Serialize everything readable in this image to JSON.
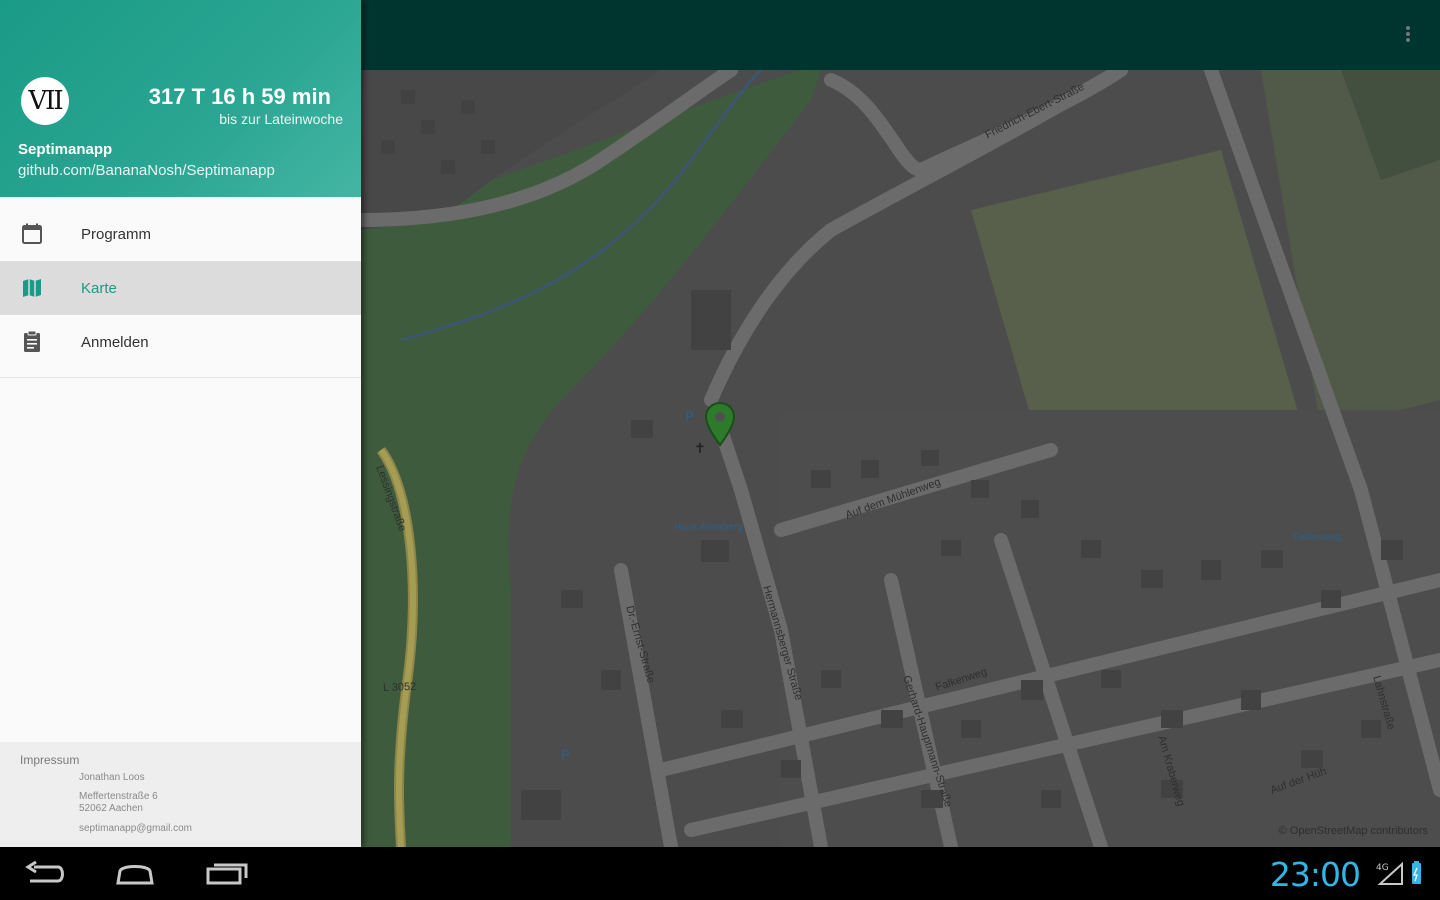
{
  "drawer": {
    "logo_text": "VII",
    "countdown": "317 T 16 h 59 min",
    "countdown_subtitle": "bis zur Lateinwoche",
    "app_name": "Septimanapp",
    "app_url": "github.com/BananaNosh/Septimanapp",
    "nav_items": [
      {
        "label": "Programm",
        "icon": "calendar-icon",
        "active": false
      },
      {
        "label": "Karte",
        "icon": "map-icon",
        "active": true
      },
      {
        "label": "Anmelden",
        "icon": "clipboard-icon",
        "active": false
      }
    ],
    "imprint": {
      "title": "Impressum",
      "lines": [
        "Jonathan Loos",
        "Meffertenstraße 6",
        "52062 Aachen",
        "septimanapp@gmail.com"
      ]
    }
  },
  "map": {
    "credit": "© OpenStreetMap contributors",
    "streets": [
      "Friedrich-Ebert-Straße",
      "Auf dem Mühlenweg",
      "Falkenweg",
      "Gerhard-Hauptmann-Straße",
      "Am Kraberweg",
      "Auf der Hüh",
      "Hermannsberger Straße",
      "Dr.-Ernst-Straße",
      "Lessingstraße",
      "L 3052",
      "Lahnstraße"
    ],
    "pois": [
      "Haus Annaberg",
      "Falkenweg"
    ]
  },
  "statusbar": {
    "time": "23:00",
    "network": "4G"
  },
  "colors": {
    "accent": "#1a9b87",
    "appbar": "#00352f",
    "clock": "#33b5e5"
  }
}
